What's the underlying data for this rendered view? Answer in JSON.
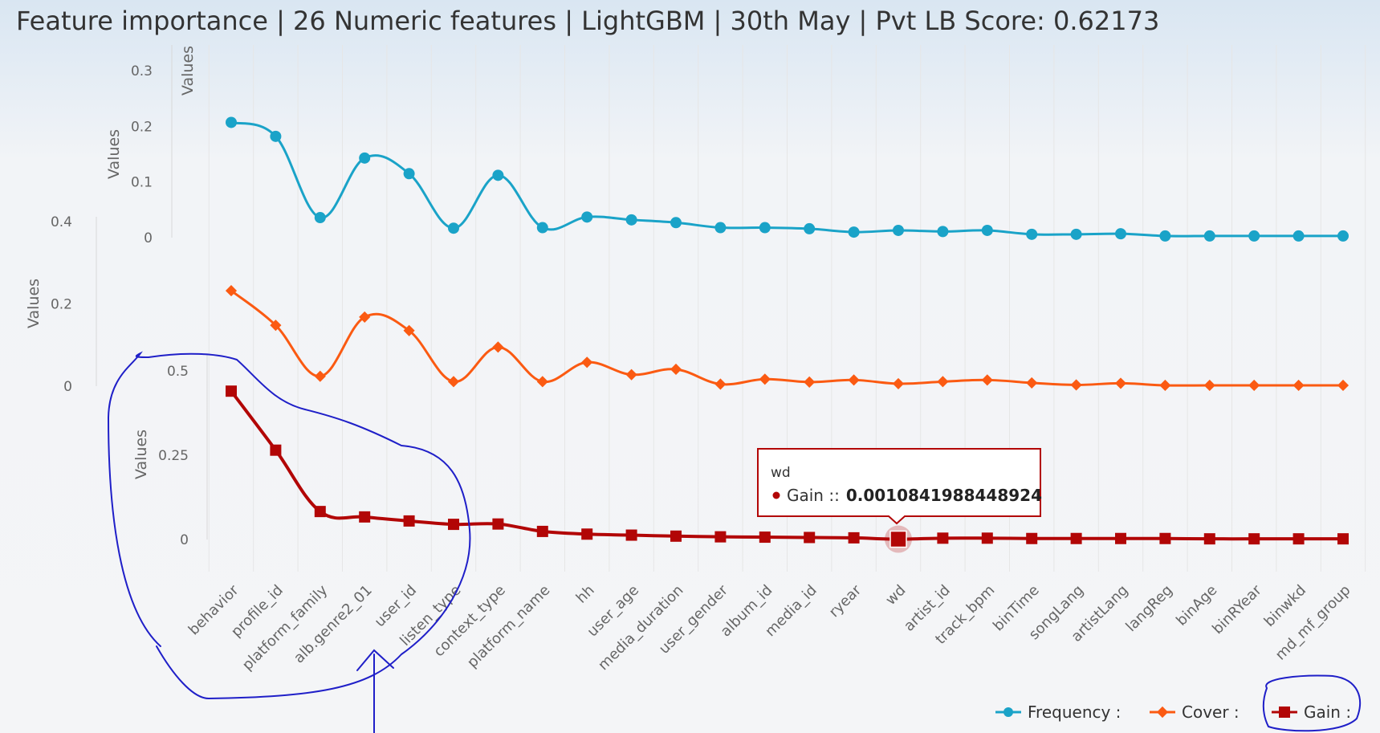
{
  "title": "Feature importance | 26 Numeric features | LightGBM | 30th May | Pvt LB Score: 0.62173",
  "colors": {
    "frequency": "#1aa3c8",
    "cover": "#fb5a12",
    "gain": "#b20606",
    "annotation": "#1f1fc8"
  },
  "chart_data": {
    "type": "line",
    "categories": [
      "behavior",
      "profile_id",
      "platform_family",
      "alb.genre2_01",
      "user_id",
      "listen_type",
      "context_type",
      "platform_name",
      "hh",
      "user_age",
      "media_duration",
      "user_gender",
      "album_id",
      "media_id",
      "ryear",
      "wd",
      "artist_id",
      "track_bpm",
      "binTime",
      "songLang",
      "artistLang",
      "langReg",
      "binAge",
      "binRYear",
      "binwkd",
      "md_mf_group"
    ],
    "series": [
      {
        "name": "Frequency :",
        "marker": "circle",
        "axis": {
          "label": "Values",
          "ticks": [
            "0",
            "0.1",
            "0.2",
            "0.3"
          ],
          "ylim": [
            0,
            0.3
          ]
        },
        "values": [
          0.207,
          0.182,
          0.036,
          0.143,
          0.115,
          0.017,
          0.112,
          0.018,
          0.037,
          0.032,
          0.027,
          0.018,
          0.018,
          0.016,
          0.01,
          0.013,
          0.011,
          0.013,
          0.006,
          0.006,
          0.007,
          0.003,
          0.003,
          0.003,
          0.003,
          0.003
        ]
      },
      {
        "name": "Cover :",
        "marker": "diamond",
        "axis": {
          "label": "Values",
          "ticks": [
            "0",
            "0.2",
            "0.4"
          ],
          "ylim": [
            0,
            0.4
          ]
        },
        "values": [
          0.232,
          0.148,
          0.024,
          0.168,
          0.135,
          0.011,
          0.095,
          0.011,
          0.058,
          0.028,
          0.041,
          0.005,
          0.017,
          0.01,
          0.015,
          0.006,
          0.011,
          0.015,
          0.008,
          0.003,
          0.007,
          0.002,
          0.002,
          0.002,
          0.002,
          0.002
        ]
      },
      {
        "name": "Gain :",
        "marker": "square",
        "axis": {
          "label": "Values",
          "ticks": [
            "0",
            "0.25",
            "0.5"
          ],
          "ylim": [
            0,
            0.5
          ]
        },
        "values": [
          0.44,
          0.265,
          0.083,
          0.067,
          0.055,
          0.045,
          0.046,
          0.024,
          0.016,
          0.013,
          0.01,
          0.008,
          0.007,
          0.006,
          0.005,
          0.0010841988448924,
          0.004,
          0.004,
          0.003,
          0.003,
          0.003,
          0.003,
          0.002,
          0.002,
          0.002,
          0.002
        ]
      }
    ],
    "legend_position": "bottom-right",
    "grid": "vertical",
    "tooltip": {
      "category": "wd",
      "series_label": "Gain ::",
      "value": "0.0010841988448924"
    }
  }
}
